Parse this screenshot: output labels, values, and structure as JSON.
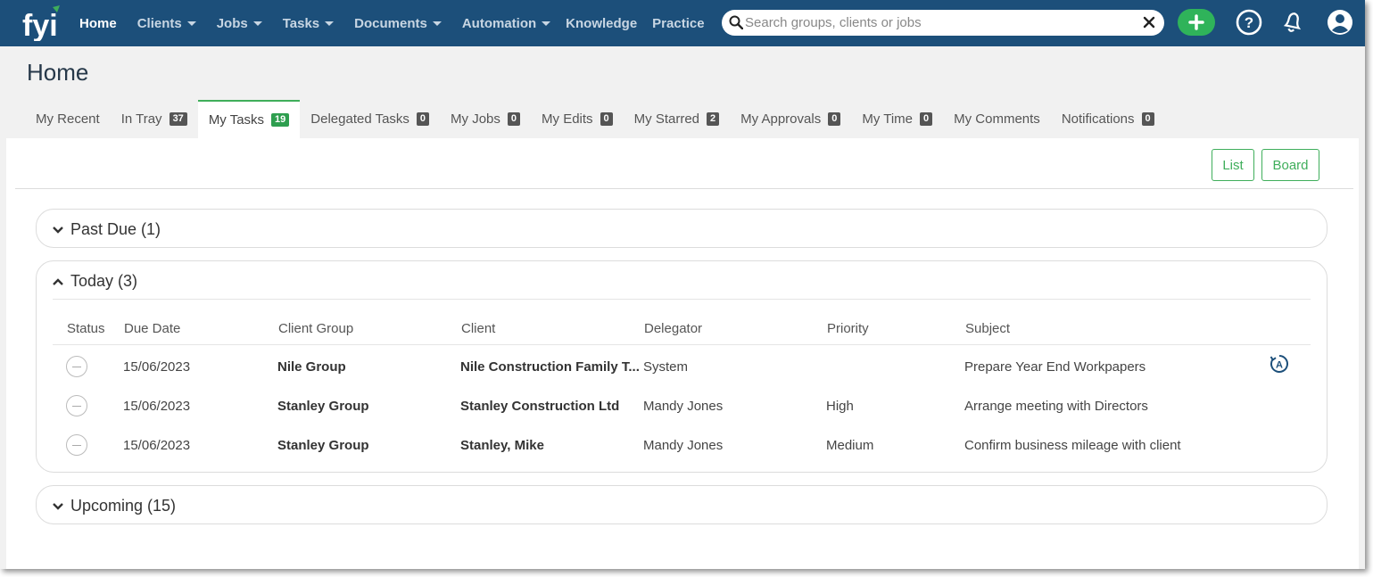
{
  "nav": {
    "home": "Home",
    "clients": "Clients",
    "jobs": "Jobs",
    "tasks": "Tasks",
    "documents": "Documents",
    "automation": "Automation",
    "knowledge": "Knowledge",
    "practice": "Practice"
  },
  "search": {
    "placeholder": "Search groups, clients or jobs"
  },
  "page": {
    "title": "Home"
  },
  "tabs": [
    {
      "label": "My Recent",
      "count": ""
    },
    {
      "label": "In Tray",
      "count": "37"
    },
    {
      "label": "My Tasks",
      "count": "19"
    },
    {
      "label": "Delegated Tasks",
      "count": "0"
    },
    {
      "label": "My Jobs",
      "count": "0"
    },
    {
      "label": "My Edits",
      "count": "0"
    },
    {
      "label": "My Starred",
      "count": "2"
    },
    {
      "label": "My Approvals",
      "count": "0"
    },
    {
      "label": "My Time",
      "count": "0"
    },
    {
      "label": "My Comments",
      "count": ""
    },
    {
      "label": "Notifications",
      "count": "0"
    }
  ],
  "view": {
    "list": "List",
    "board": "Board"
  },
  "sections": {
    "past_due": "Past Due (1)",
    "today": "Today (3)",
    "upcoming": "Upcoming (15)"
  },
  "columns": {
    "status": "Status",
    "due_date": "Due Date",
    "client_group": "Client Group",
    "client": "Client",
    "delegator": "Delegator",
    "priority": "Priority",
    "subject": "Subject"
  },
  "rows": [
    {
      "due": "15/06/2023",
      "group": "Nile Group",
      "client": "Nile Construction Family T...",
      "delegator": "System",
      "priority": "",
      "subject": "Prepare Year End Workpapers"
    },
    {
      "due": "15/06/2023",
      "group": "Stanley Group",
      "client": "Stanley Construction Ltd",
      "delegator": "Mandy Jones",
      "priority": "High",
      "subject": "Arrange meeting with Directors"
    },
    {
      "due": "15/06/2023",
      "group": "Stanley Group",
      "client": "Stanley, Mike",
      "delegator": "Mandy Jones",
      "priority": "Medium",
      "subject": "Confirm business mileage with client"
    }
  ],
  "colors": {
    "nav_bg": "#1c4f7a",
    "accent_green": "#3fae5b",
    "badge_dark": "#555555"
  }
}
